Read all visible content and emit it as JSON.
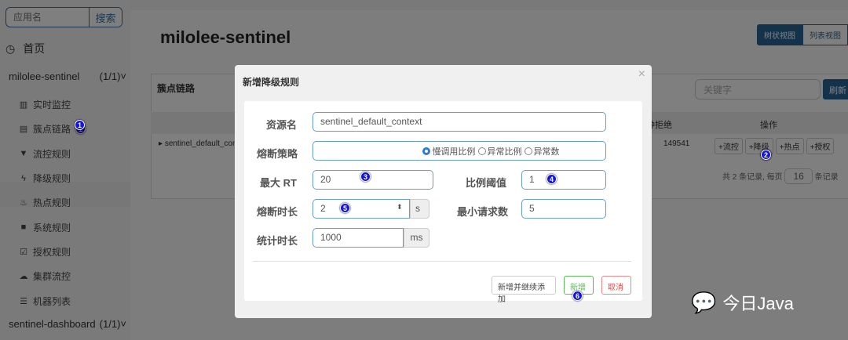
{
  "sidebar": {
    "search_placeholder": "应用名",
    "search_button": "搜索",
    "home": "首页",
    "app_group": {
      "name": "milolee-sentinel",
      "count": "(1/1)"
    },
    "items": [
      {
        "label": "实时监控",
        "icon": "bar-chart-icon"
      },
      {
        "label": "簇点链路",
        "icon": "list-icon"
      },
      {
        "label": "流控规则",
        "icon": "filter-icon"
      },
      {
        "label": "降级规则",
        "icon": "flash-icon"
      },
      {
        "label": "热点规则",
        "icon": "fire-icon"
      },
      {
        "label": "系统规则",
        "icon": "lock-icon"
      },
      {
        "label": "授权规则",
        "icon": "check-icon"
      },
      {
        "label": "集群流控",
        "icon": "cloud-icon"
      },
      {
        "label": "机器列表",
        "icon": "th-list-icon"
      }
    ],
    "other_group": {
      "name": "sentinel-dashboard",
      "count": "(1/1)"
    }
  },
  "main": {
    "title": "milolee-sentinel",
    "view_tree": "树状视图",
    "view_list": "列表视图",
    "panel_title": "簇点链路",
    "keyword_placeholder": "关键字",
    "refresh": "刷新",
    "columns": {
      "reject": "分钟拒绝",
      "ops": "操作"
    },
    "row": {
      "resource": "sentinel_default_context",
      "reject": "149541",
      "ops": [
        "+流控",
        "+降级",
        "+热点",
        "+授权"
      ]
    },
    "pagination": {
      "prefix": "共 2 条记录, 每页",
      "page_size": "16",
      "suffix": "条记录"
    }
  },
  "modal": {
    "title": "新增降级规则",
    "close": "×",
    "resource_label": "资源名",
    "resource_value": "sentinel_default_context",
    "strategy_label": "熔断策略",
    "strategies": [
      "慢调用比例",
      "异常比例",
      "异常数"
    ],
    "strategy_selected": "慢调用比例",
    "max_rt_label": "最大 RT",
    "max_rt": "20",
    "ratio_label": "比例阈值",
    "ratio": "1",
    "duration_label": "熔断时长",
    "duration": "2",
    "duration_unit": "s",
    "min_req_label": "最小请求数",
    "min_req": "5",
    "stat_label": "统计时长",
    "stat": "1000",
    "stat_unit": "ms",
    "btn_add_continue": "新增并继续添加",
    "btn_add": "新增",
    "btn_cancel": "取消"
  },
  "badges": [
    "1",
    "2",
    "3",
    "4",
    "5",
    "6"
  ],
  "watermark": "今日Java",
  "colors": {
    "primary": "#2b6496",
    "success": "#5cb85c",
    "danger": "#d9534f",
    "badge": "#1515e0"
  }
}
